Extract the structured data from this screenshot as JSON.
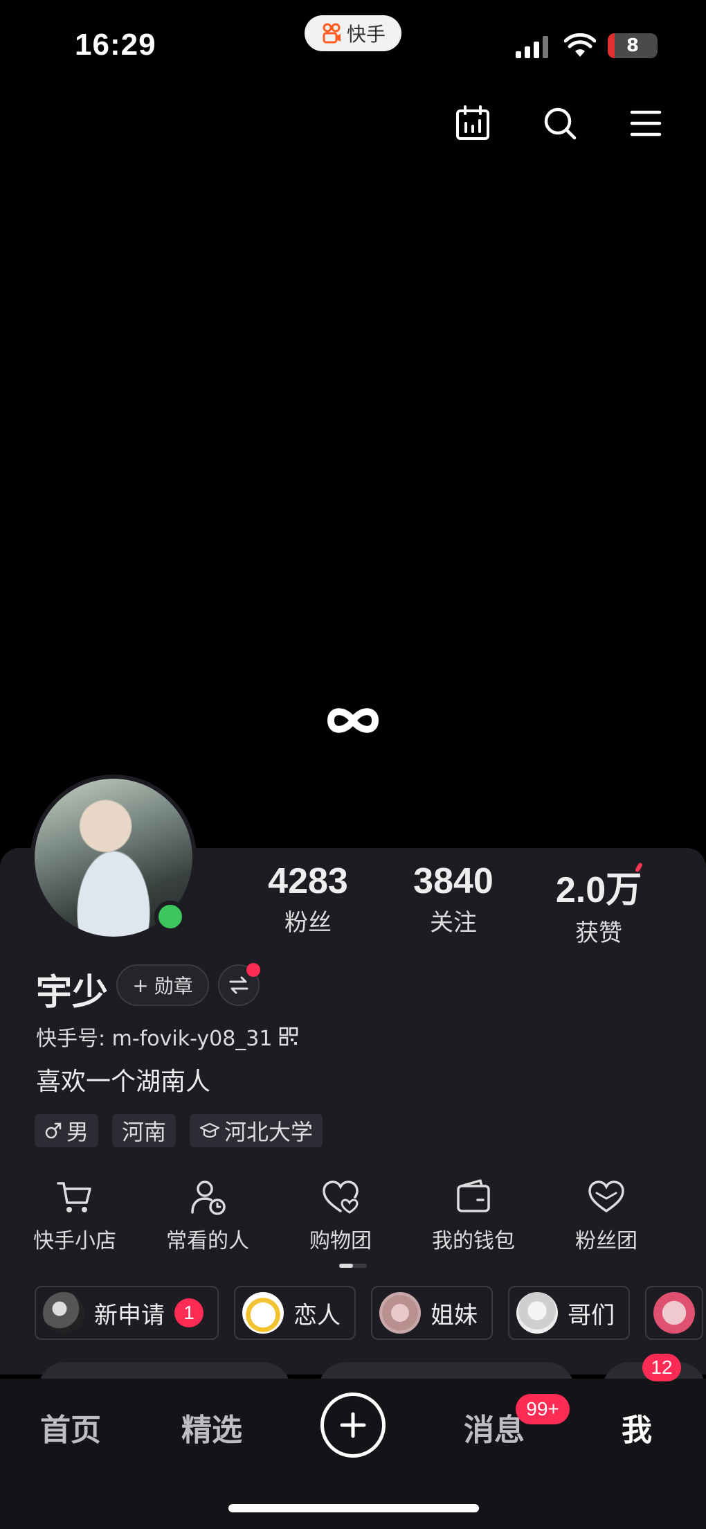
{
  "status_bar": {
    "time": "16:29",
    "app_pill": "快手",
    "battery": "8"
  },
  "profile": {
    "stats": [
      {
        "value": "4283",
        "label": "粉丝"
      },
      {
        "value": "3840",
        "label": "关注"
      },
      {
        "value": "2.0万",
        "label": "获赞"
      }
    ],
    "name": "宇少",
    "medal_label": "勋章",
    "kuaishou_id": "快手号: m-fovik-y08_31",
    "bio": "喜欢一个湖南人",
    "tags": {
      "gender": "男",
      "region": "河南",
      "school": "河北大学"
    }
  },
  "tools": [
    {
      "label": "快手小店",
      "icon": "cart-icon"
    },
    {
      "label": "常看的人",
      "icon": "person-clock-icon"
    },
    {
      "label": "购物团",
      "icon": "heart-group-icon"
    },
    {
      "label": "我的钱包",
      "icon": "wallet-icon"
    },
    {
      "label": "粉丝团",
      "icon": "heart-icon"
    }
  ],
  "chips": [
    {
      "label": "新申请",
      "badge": "1"
    },
    {
      "label": "恋人"
    },
    {
      "label": "姐妹"
    },
    {
      "label": "哥们"
    }
  ],
  "nav": {
    "home": "首页",
    "featured": "精选",
    "messages": "消息",
    "messages_badge": "99+",
    "me": "我",
    "peek_badge": "12"
  },
  "colors": {
    "accent": "#fe2c55",
    "online": "#3cc65c",
    "card": "#1c1c22"
  }
}
